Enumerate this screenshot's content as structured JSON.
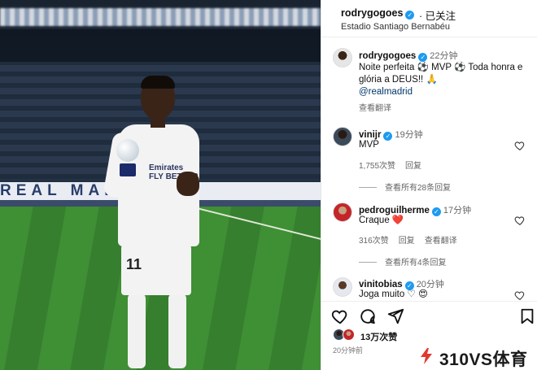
{
  "photo": {
    "banner_text": "REAL MADRID",
    "shirt_text": "Emirates FLY BETTER",
    "shorts_number": "11"
  },
  "header": {
    "username": "rodrygogoes",
    "follow_status": "· 已关注",
    "location": "Estadio Santiago Bernabéu"
  },
  "caption": {
    "username": "rodrygogoes",
    "time": "22分钟",
    "text": "Noite perfeita ⚽ MVP ⚽ Toda honra e glória a DEUS!! 🙏",
    "mention": "@realmadrid",
    "translate": "查看翻译"
  },
  "comments": [
    {
      "username": "vinijr",
      "time": "19分钟",
      "text": "MVP",
      "likes": "1,755次赞",
      "reply": "回复",
      "translate": "",
      "view_replies": "查看所有28条回复"
    },
    {
      "username": "pedroguilherme",
      "time": "17分钟",
      "text": "Craque ❤️",
      "likes": "316次赞",
      "reply": "回复",
      "translate": "查看翻译",
      "view_replies": "查看所有4条回复"
    },
    {
      "username": "vinitobias",
      "time": "20分钟",
      "text": "Joga muito ♡ 😍",
      "likes": "",
      "reply": "",
      "translate": "",
      "view_replies": ""
    }
  ],
  "actions": {
    "like_icon": "heart-icon",
    "comment_icon": "comment-icon",
    "share_icon": "share-icon",
    "save_icon": "bookmark-icon"
  },
  "likes_total": "13万次赞",
  "post_time": "20分钟前",
  "watermark": "310VS体育",
  "colors": {
    "verified": "#1d9bf0",
    "link": "#00376b",
    "watermark_red": "#e03a2f"
  }
}
